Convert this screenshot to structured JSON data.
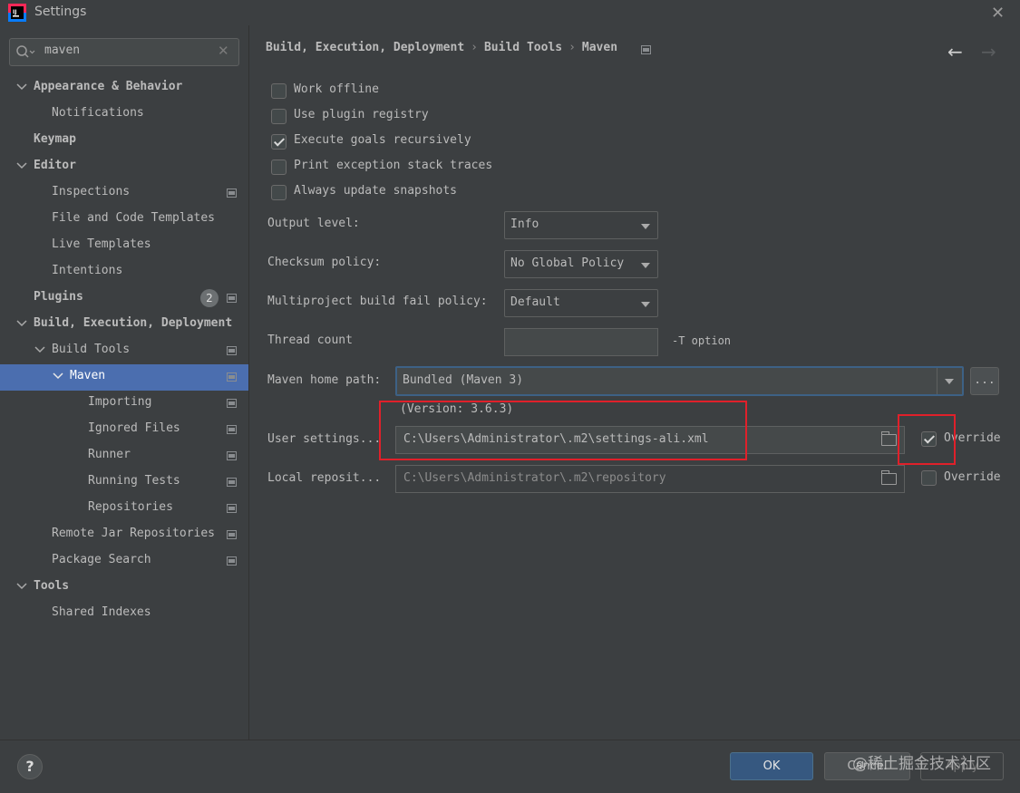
{
  "window": {
    "title": "Settings"
  },
  "search": {
    "value": "maven"
  },
  "sidebar": {
    "items": [
      {
        "label": "Appearance & Behavior",
        "bold": true
      },
      {
        "label": "Notifications"
      },
      {
        "label": "Keymap",
        "bold": true
      },
      {
        "label": "Editor",
        "bold": true
      },
      {
        "label": "Inspections"
      },
      {
        "label": "File and Code Templates"
      },
      {
        "label": "Live Templates"
      },
      {
        "label": "Intentions"
      },
      {
        "label": "Plugins",
        "bold": true,
        "badge": "2"
      },
      {
        "label": "Build, Execution, Deployment",
        "bold": true
      },
      {
        "label": "Build Tools"
      },
      {
        "label": "Maven"
      },
      {
        "label": "Importing"
      },
      {
        "label": "Ignored Files"
      },
      {
        "label": "Runner"
      },
      {
        "label": "Running Tests"
      },
      {
        "label": "Repositories"
      },
      {
        "label": "Remote Jar Repositories"
      },
      {
        "label": "Package Search"
      },
      {
        "label": "Tools",
        "bold": true
      },
      {
        "label": "Shared Indexes"
      }
    ]
  },
  "breadcrumb": {
    "part1": "Build, Execution, Deployment",
    "part2": "Build Tools",
    "part3": "Maven",
    "separator": "›"
  },
  "options": {
    "work_offline": {
      "label": "Work offline",
      "checked": false
    },
    "use_plugin_registry": {
      "label": "Use plugin registry",
      "checked": false
    },
    "execute_goals_recursively": {
      "label": "Execute goals recursively",
      "checked": true
    },
    "print_exception_stack_traces": {
      "label": "Print exception stack traces",
      "checked": false
    },
    "always_update_snapshots": {
      "label": "Always update snapshots",
      "checked": false
    }
  },
  "form": {
    "output_level": {
      "label": "Output level:",
      "value": "Info"
    },
    "checksum_policy": {
      "label": "Checksum policy:",
      "value": "No Global Policy"
    },
    "build_fail_policy": {
      "label": "Multiproject build fail policy:",
      "value": "Default"
    },
    "thread_count": {
      "label": "Thread count",
      "value": "",
      "hint": "-T option"
    },
    "maven_home": {
      "label": "Maven home path:",
      "value": "Bundled (Maven 3)",
      "browse": "...",
      "version": "(Version: 3.6.3)"
    },
    "user_settings": {
      "label": "User settings...",
      "value": "C:\\Users\\Administrator\\.m2\\settings-ali.xml",
      "override_label": "Override",
      "override_checked": true
    },
    "local_repository": {
      "label": "Local reposit...",
      "value": "C:\\Users\\Administrator\\.m2\\repository",
      "override_label": "Override",
      "override_checked": false
    }
  },
  "buttons": {
    "help": "?",
    "ok": "OK",
    "cancel": "Cancel",
    "apply": "Apply"
  },
  "watermark": "@稀土掘金技术社区",
  "colors": {
    "selection": "#4b6eaf",
    "highlight_box": "#e0202a",
    "ok_button": "#365880"
  }
}
